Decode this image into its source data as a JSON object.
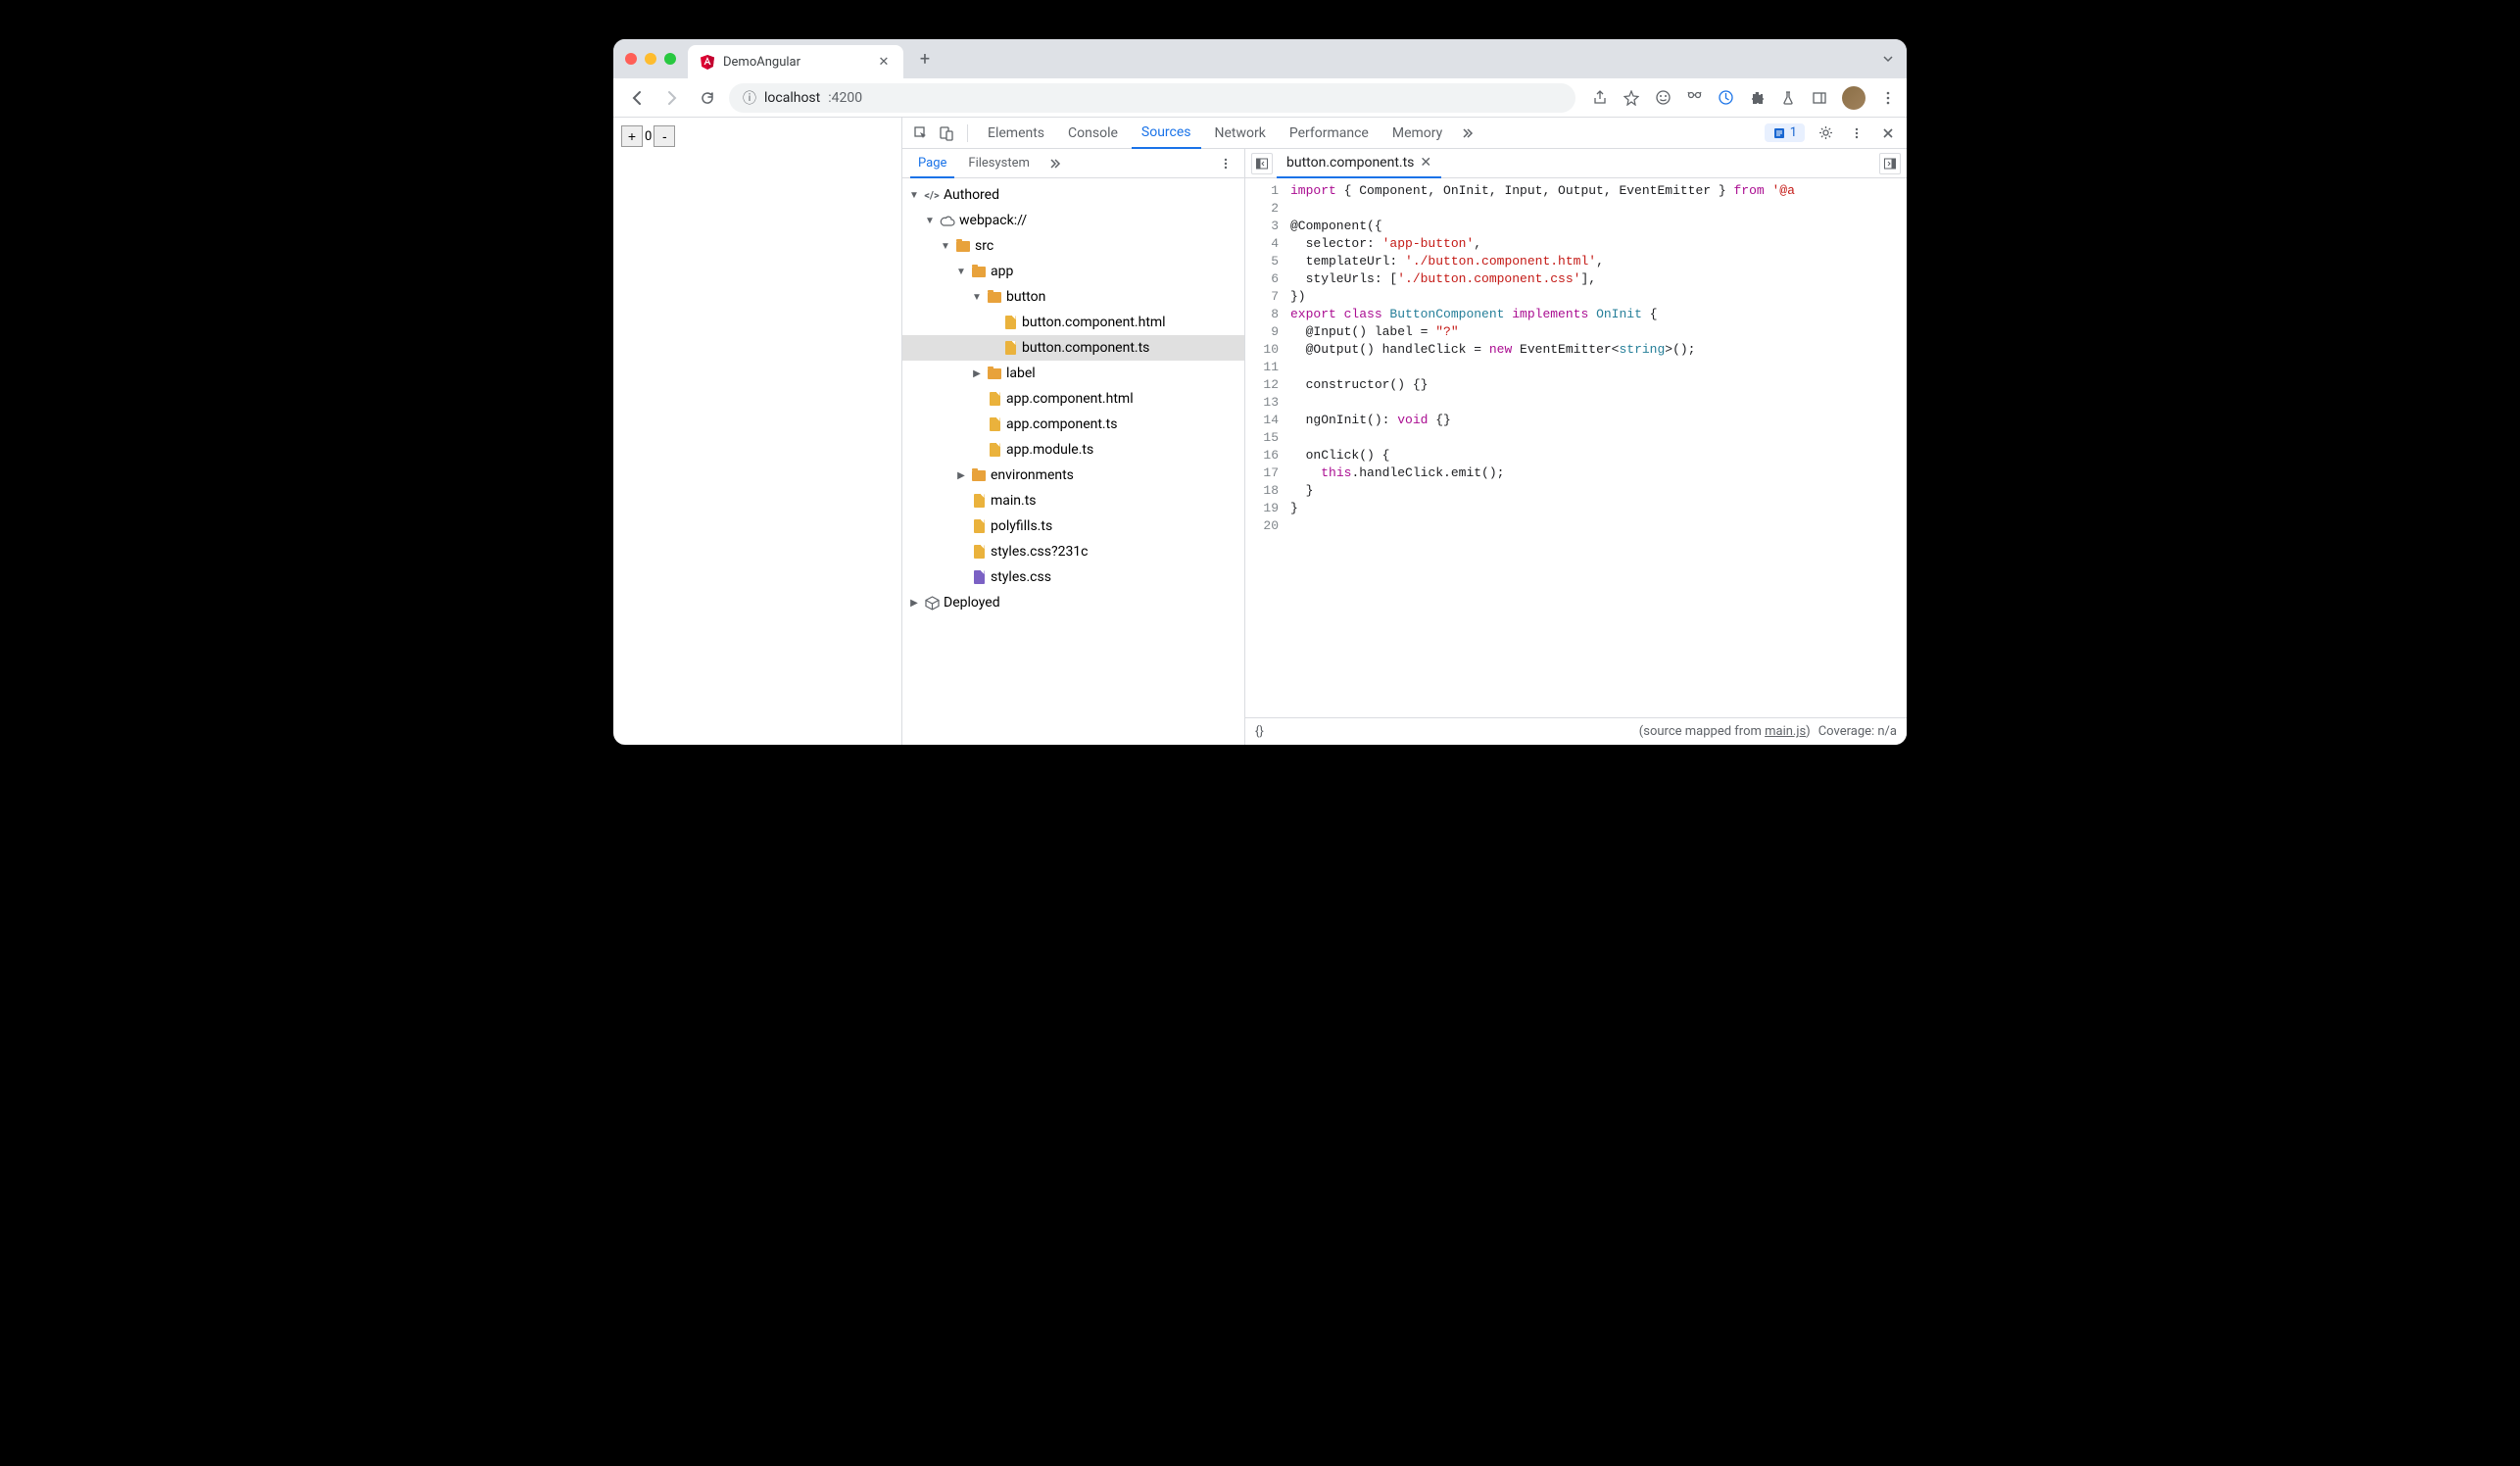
{
  "browser": {
    "tab_title": "DemoAngular",
    "url_host": "localhost",
    "url_port": ":4200"
  },
  "page": {
    "counter_value": "0"
  },
  "devtools": {
    "tabs": [
      "Elements",
      "Console",
      "Sources",
      "Network",
      "Performance",
      "Memory"
    ],
    "active_tab": "Sources",
    "issue_count": "1",
    "nav_tabs": [
      "Page",
      "Filesystem"
    ],
    "active_nav_tab": "Page"
  },
  "tree": {
    "authored": "Authored",
    "webpack": "webpack://",
    "src": "src",
    "app": "app",
    "button": "button",
    "btn_html": "button.component.html",
    "btn_ts": "button.component.ts",
    "label": "label",
    "app_html": "app.component.html",
    "app_ts": "app.component.ts",
    "app_module": "app.module.ts",
    "environments": "environments",
    "main_ts": "main.ts",
    "polyfills": "polyfills.ts",
    "styles_q": "styles.css?231c",
    "styles": "styles.css",
    "deployed": "Deployed"
  },
  "editor": {
    "open_file": "button.component.ts",
    "source_mapped_prefix": "(source mapped from ",
    "source_mapped_link": "main.js",
    "source_mapped_suffix": ")",
    "coverage": "Coverage: n/a"
  },
  "code": {
    "l1_import": "import",
    "l1_rest": " { Component, OnInit, Input, Output, EventEmitter } ",
    "l1_from": "from",
    "l1_pkg": " '@a",
    "l3": "@Component({",
    "l4a": "  selector: ",
    "l4b": "'app-button'",
    "l4c": ",",
    "l5a": "  templateUrl: ",
    "l5b": "'./button.component.html'",
    "l5c": ",",
    "l6a": "  styleUrls: [",
    "l6b": "'./button.component.css'",
    "l6c": "],",
    "l7": "})",
    "l8a": "export",
    "l8b": " class",
    "l8c": " ButtonComponent",
    "l8d": " implements",
    "l8e": " OnInit",
    "l8f": " {",
    "l9a": "  @Input() label = ",
    "l9b": "\"?\"",
    "l10a": "  @Output() handleClick = ",
    "l10b": "new",
    "l10c": " EventEmitter<",
    "l10d": "string",
    "l10e": ">();",
    "l12": "  constructor() {}",
    "l14a": "  ngOnInit(): ",
    "l14b": "void",
    "l14c": " {}",
    "l16": "  onClick() {",
    "l17a": "    ",
    "l17b": "this",
    "l17c": ".handleClick.emit();",
    "l18": "  }",
    "l19": "}"
  }
}
